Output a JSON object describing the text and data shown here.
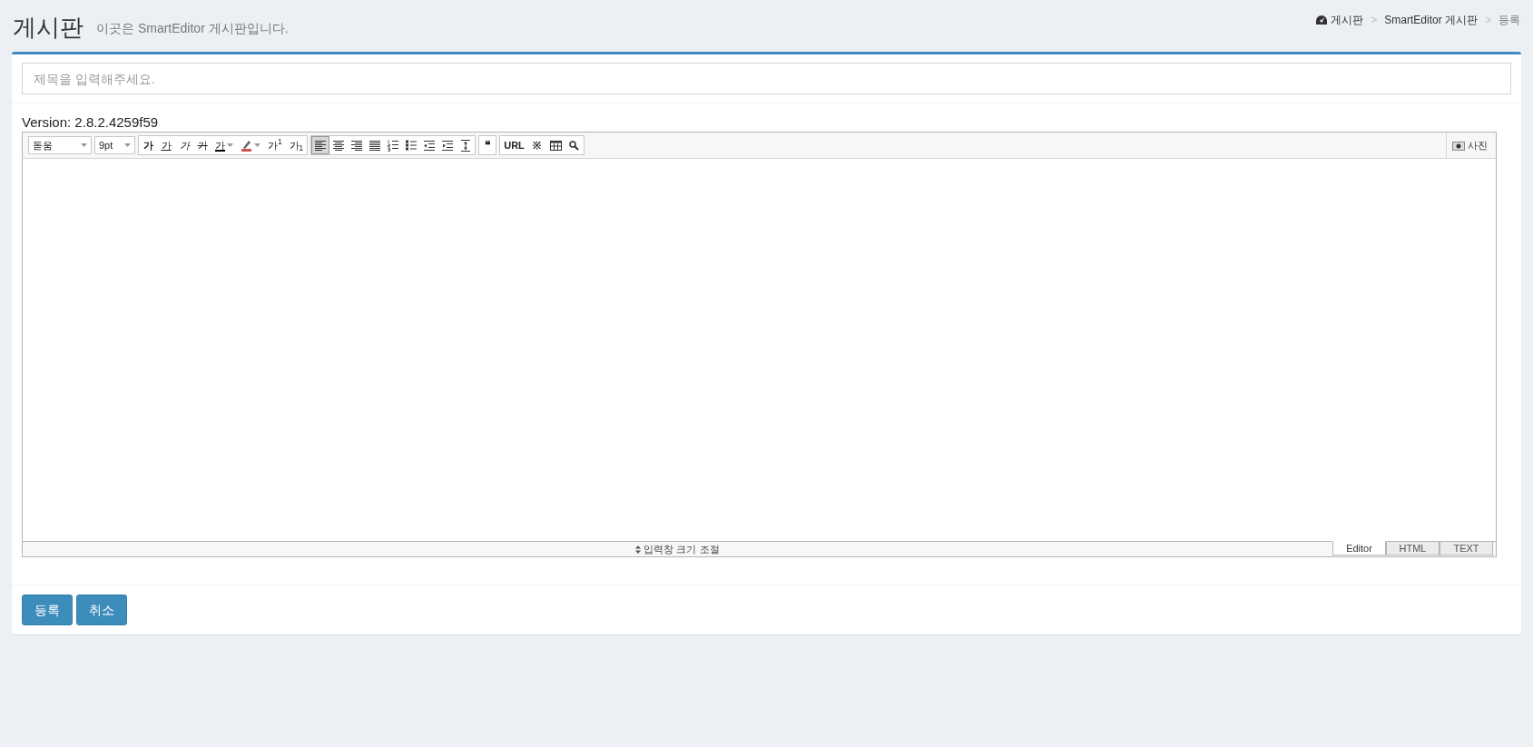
{
  "header": {
    "title": "게시판",
    "subtitle": "이곳은 SmartEditor 게시판입니다."
  },
  "breadcrumb": [
    {
      "label": "게시판",
      "kind": "home"
    },
    {
      "label": "SmartEditor 게시판",
      "kind": "link"
    },
    {
      "label": "등록",
      "kind": "current"
    }
  ],
  "breadcrumb_separators": [
    ">",
    ">"
  ],
  "title_field": {
    "placeholder": "제목을 입력해주세요."
  },
  "version": "Version: 2.8.2.4259f59",
  "toolbar": {
    "font": "돋움",
    "size": "9pt",
    "format_buttons": [
      {
        "label": "가",
        "kind": "bold"
      },
      {
        "label": "가",
        "kind": "underline"
      },
      {
        "label": "가",
        "kind": "italic"
      },
      {
        "label": "가",
        "kind": "strike"
      },
      {
        "label": "가",
        "kind": "color"
      },
      {
        "kind": "highlight"
      },
      {
        "label": "가$^{1}$",
        "kind": "plain"
      },
      {
        "label": "가$_{1}$",
        "kind": "plain"
      }
    ],
    "align_buttons": [
      {
        "kind": "align-left",
        "selected": true
      },
      {
        "kind": "align-center",
        "selected": false
      },
      {
        "kind": "align-right",
        "selected": false
      },
      {
        "kind": "justify",
        "selected": false
      },
      {
        "kind": "ordered-list",
        "selected": false
      },
      {
        "kind": "bullet-list",
        "selected": false
      },
      {
        "kind": "outdent",
        "selected": false
      },
      {
        "kind": "indent",
        "selected": false
      },
      {
        "kind": "line-height",
        "selected": false
      }
    ],
    "quote": "❝",
    "insert_buttons": [
      {
        "label": "URL",
        "kind": "text"
      },
      {
        "label": "※",
        "kind": "text"
      },
      {
        "kind": "table"
      },
      {
        "kind": "search"
      }
    ],
    "photo": "사진"
  },
  "resize_label": "입력창 크기 조절",
  "mode_tabs": [
    {
      "label": "Editor",
      "selected": true
    },
    {
      "label": "HTML",
      "selected": false
    },
    {
      "label": "TEXT",
      "selected": false
    }
  ],
  "buttons": [
    "등록",
    "취소"
  ]
}
